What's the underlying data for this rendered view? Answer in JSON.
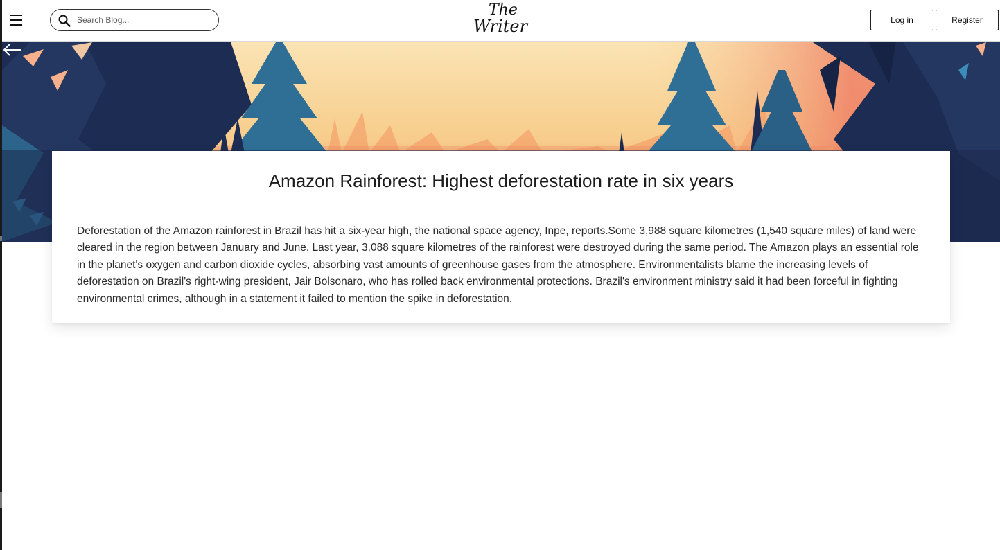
{
  "header": {
    "search_placeholder": "Search Blog...",
    "logo_line1": "The",
    "logo_line2": "Writer",
    "login_label": "Log in",
    "register_label": "Register"
  },
  "hero": {
    "colors": {
      "sky_light": "#f8d9a6",
      "sky_mid": "#f7c988",
      "sky_orange": "#f39b6e",
      "trees_dark": "#1c2a4e",
      "trees_teal": "#2f6f96"
    }
  },
  "article": {
    "title": "Amazon Rainforest: Highest deforestation rate in six years",
    "body": "Deforestation of the Amazon rainforest in Brazil has hit a six-year high, the national space agency, Inpe, reports.Some 3,988 square kilometres (1,540 square miles) of land were cleared in the region between January and June. Last year, 3,088 square kilometres of the rainforest were destroyed during the same period. The Amazon plays an essential role in the planet's oxygen and carbon dioxide cycles, absorbing vast amounts of greenhouse gases from the atmosphere. Environmentalists blame the increasing levels of deforestation on Brazil's right-wing president, Jair Bolsonaro, who has rolled back environmental protections. Brazil's environment ministry said it had been forceful in fighting environmental crimes, although in a statement it failed to mention the spike in deforestation."
  }
}
